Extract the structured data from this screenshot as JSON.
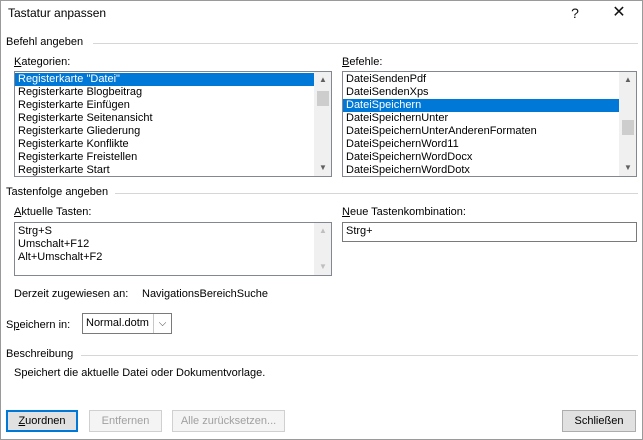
{
  "window": {
    "title": "Tastatur anpassen",
    "help_glyph": "?",
    "close_glyph": "✕"
  },
  "command_section": {
    "label": "Befehl angeben",
    "categories_label_key": "K",
    "categories_label_rest": "ategorien:",
    "categories": [
      {
        "label": "Registerkarte \"Datei\"",
        "selected": true
      },
      {
        "label": "Registerkarte Blogbeitrag",
        "selected": false
      },
      {
        "label": "Registerkarte Einfügen",
        "selected": false
      },
      {
        "label": "Registerkarte Seitenansicht",
        "selected": false
      },
      {
        "label": "Registerkarte Gliederung",
        "selected": false
      },
      {
        "label": "Registerkarte Konflikte",
        "selected": false
      },
      {
        "label": "Registerkarte Freistellen",
        "selected": false
      },
      {
        "label": "Registerkarte Start",
        "selected": false
      }
    ],
    "commands_label_key": "B",
    "commands_label_rest": "efehle:",
    "commands": [
      {
        "label": "DateiSendenPdf",
        "selected": false
      },
      {
        "label": "DateiSendenXps",
        "selected": false
      },
      {
        "label": "DateiSpeichern",
        "selected": true
      },
      {
        "label": "DateiSpeichernUnter",
        "selected": false
      },
      {
        "label": "DateiSpeichernUnterAnderenFormaten",
        "selected": false
      },
      {
        "label": "DateiSpeichernWord11",
        "selected": false
      },
      {
        "label": "DateiSpeichernWordDocx",
        "selected": false
      },
      {
        "label": "DateiSpeichernWordDotx",
        "selected": false
      }
    ]
  },
  "keys_section": {
    "label": "Tastenfolge angeben",
    "current_label_key": "A",
    "current_label_rest": "ktuelle Tasten:",
    "current_keys": [
      "Strg+S",
      "Umschalt+F12",
      "Alt+Umschalt+F2"
    ],
    "new_label_key": "N",
    "new_label_rest": "eue Tastenkombination:",
    "new_combo_value": "Strg+",
    "assigned_label": "Derzeit zugewiesen an:",
    "assigned_value": "NavigationsBereichSuche",
    "save_in_label_pre": "S",
    "save_in_label_key": "p",
    "save_in_label_rest": "eichern in:",
    "save_in_value": "Normal.dotm",
    "dropdown_glyph": "⌵"
  },
  "description_section": {
    "label": "Beschreibung",
    "text": "Speichert die aktuelle Datei oder Dokumentvorlage."
  },
  "buttons": {
    "assign_key": "Z",
    "assign_rest": "uordnen",
    "remove": "Entfernen",
    "reset_all": "Alle zurücksetzen...",
    "close": "Schließen"
  }
}
